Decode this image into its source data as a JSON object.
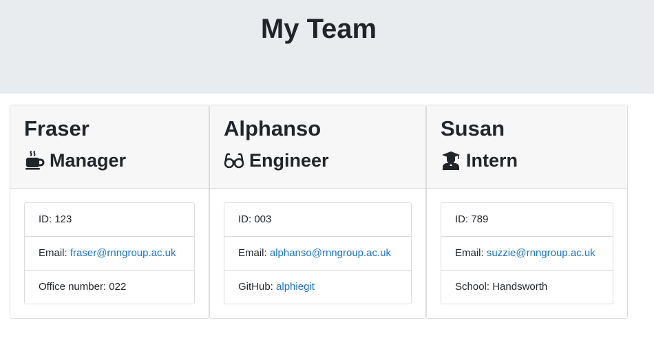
{
  "header": {
    "title": "My Team"
  },
  "employees": [
    {
      "name": "Fraser",
      "role": "Manager",
      "role_icon": "coffee-icon",
      "id_label": "ID:",
      "id": "123",
      "email_label": "Email:",
      "email": "fraser@rnngroup.ac.uk",
      "extra_label": "Office number:",
      "extra_value": "022"
    },
    {
      "name": "Alphanso",
      "role": "Engineer",
      "role_icon": "glasses-icon",
      "id_label": "ID:",
      "id": "003",
      "email_label": "Email:",
      "email": "alphanso@rnngroup.ac.uk",
      "extra_label": "GitHub:",
      "extra_value": "alphiegit"
    },
    {
      "name": "Susan",
      "role": "Intern",
      "role_icon": "graduate-icon",
      "id_label": "ID:",
      "id": "789",
      "email_label": "Email:",
      "email": "suzzie@rnngroup.ac.uk",
      "extra_label": "School:",
      "extra_value": "Handsworth"
    }
  ],
  "colors": {
    "header_bg": "#e9ecef",
    "card_header_bg": "#f7f7f7",
    "link": "#1a73c9",
    "text": "#212529",
    "border": "#dcdcdc"
  }
}
